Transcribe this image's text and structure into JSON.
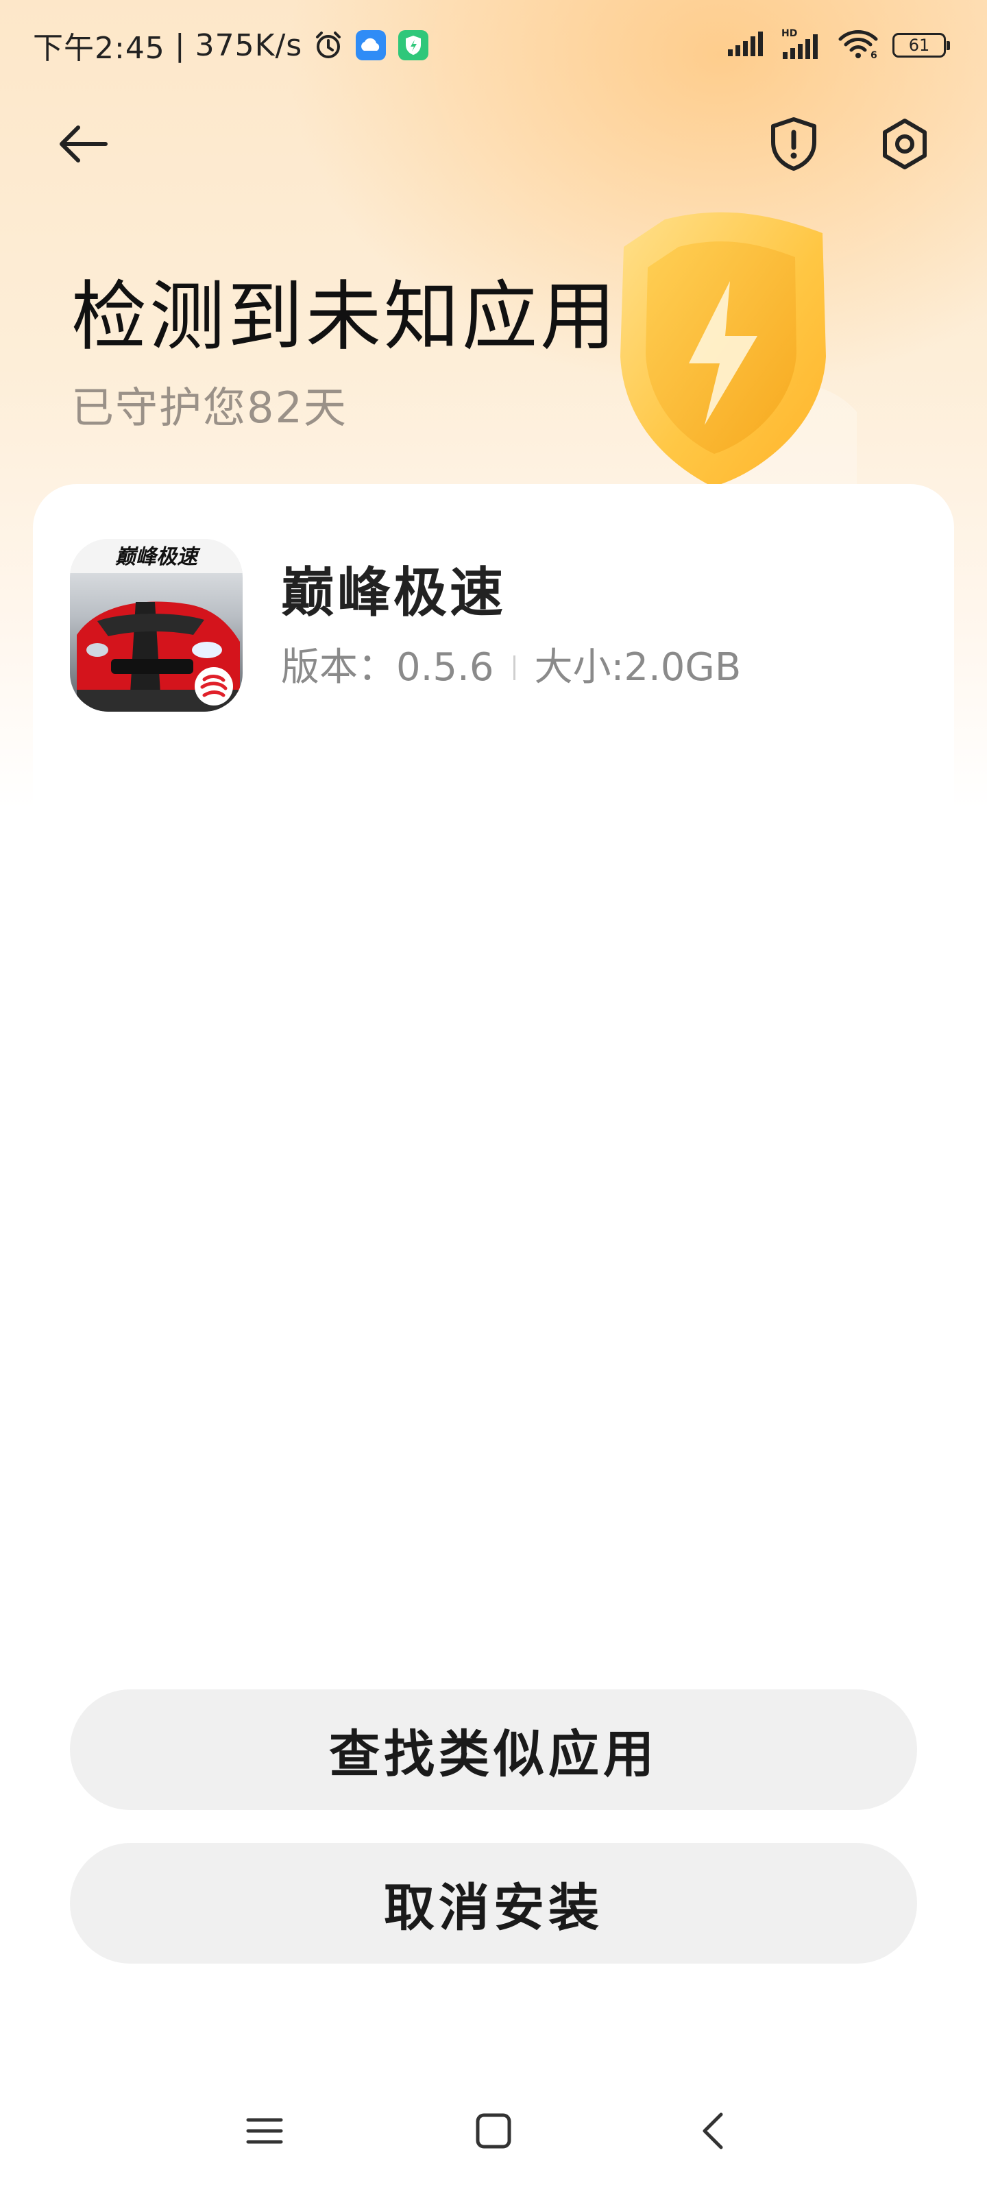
{
  "status_bar": {
    "time": "下午2:45",
    "separator": "|",
    "network_speed": "375K/s",
    "battery_level": "61",
    "icons": [
      "alarm-icon",
      "cloud-icon",
      "shield-app-icon",
      "signal-icon",
      "hd-signal-icon",
      "wifi-icon",
      "battery-icon"
    ]
  },
  "toolbar": {
    "back_icon": "arrow-left-icon",
    "report_icon": "shield-alert-icon",
    "settings_icon": "gear-icon"
  },
  "header": {
    "title": "检测到未知应用",
    "subtitle": "已守护您82天"
  },
  "app": {
    "icon_text": "巅峰极速",
    "name": "巅峰极速",
    "version_label": "版本：",
    "version": "0.5.6",
    "size_label": "大小:",
    "size": "2.0GB"
  },
  "buttons": {
    "find_similar": "查找类似应用",
    "cancel_install": "取消安装"
  },
  "navigation": {
    "menu_icon": "menu-icon",
    "home_icon": "home-square-icon",
    "back_icon": "chevron-left-icon"
  },
  "colors": {
    "header_gradient_start": "#fde7c9",
    "shield_gold": "#ffc53d",
    "button_bg": "#f0f0f0",
    "text_primary": "#111111",
    "text_secondary": "#9a9188"
  }
}
